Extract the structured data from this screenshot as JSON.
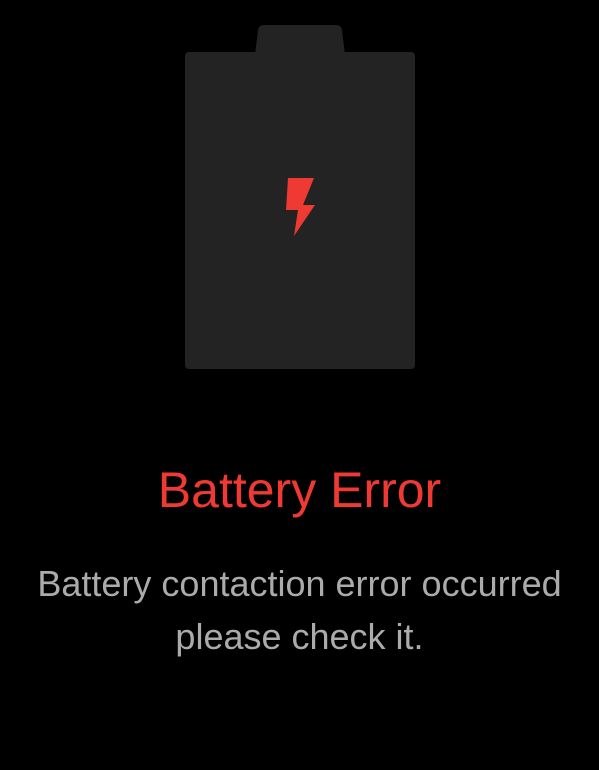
{
  "colors": {
    "background": "#000000",
    "battery_body": "#232323",
    "error_accent": "#ee3a32",
    "message_text": "#ababab"
  },
  "battery": {
    "icon": "battery-icon",
    "badge_icon": "lightning-bolt-icon"
  },
  "error": {
    "title": "Battery Error",
    "message_line_1": "Battery contaction error occurred",
    "message_line_2": "please check it."
  }
}
